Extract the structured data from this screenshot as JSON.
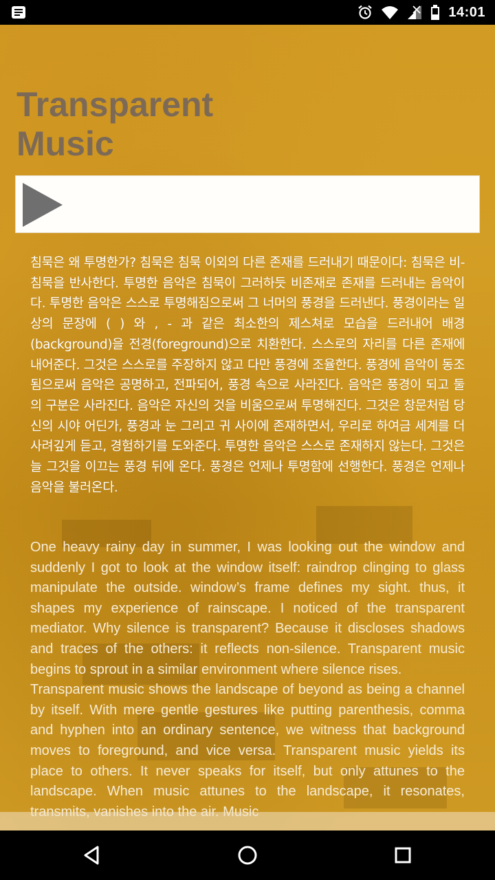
{
  "status_bar": {
    "time": "14:01",
    "icons": [
      "notification-icon",
      "alarm-icon",
      "wifi-icon",
      "signal-icon",
      "battery-icon"
    ]
  },
  "page": {
    "title_line1": "Transparent",
    "title_line2": "Music"
  },
  "player": {
    "play_icon": "play-icon"
  },
  "text": {
    "korean": "침묵은 왜 투명한가? 침묵은 침묵 이외의 다른 존재를 드러내기 때문이다: 침묵은 비-침묵을 반사한다. 투명한 음악은 침묵이 그러하듯 비존재로 존재를 드러내는 음악이다. 투명한 음악은 스스로 투명해짐으로써 그 너머의 풍경을 드러낸다. 풍경이라는 일상의 문장에 ( ) 와 , - 과 같은 최소한의 제스쳐로 모습을 드러내어 배경(background)을 전경(foreground)으로 치환한다. 스스로의 자리를 다른 존재에 내어준다. 그것은 스스로를 주장하지 않고 다만 풍경에 조율한다. 풍경에 음악이 동조됨으로써 음악은 공명하고, 전파되어, 풍경 속으로 사라진다. 음악은 풍경이 되고 둘의 구분은 사라진다. 음악은 자신의 것을 비움으로써 투명해진다. 그것은 창문처럼 당신의 시야 어딘가, 풍경과 눈 그리고 귀 사이에 존재하면서, 우리로 하여금 세계를 더 사려깊게 듣고, 경험하기를 도와준다. 투명한 음악은 스스로 존재하지 않는다. 그것은 늘 그것을 이끄는 풍경 뒤에 온다. 풍경은 언제나 투명함에 선행한다. 풍경은 언제나 음악을 불러온다.",
    "english_p1": "One heavy rainy day in summer, I was looking out the window and suddenly I got to look at the window itself: raindrop clinging to glass manipulate the outside. window’s frame defines my sight. thus, it shapes my experience of rainscape. I noticed of the transparent mediator. Why silence is transparent? Because it discloses shadows and traces of the others: it reflects non-silence. Transparent music begins to sprout in a similar environment where silence rises.",
    "english_p2": "Transparent music shows the landscape of beyond as being a channel by itself. With mere gentle gestures like putting parenthesis, comma and hyphen into an ordinary sentence, we witness that background moves to foreground, and vice versa. Transparent music yields its place to others. It never speaks for itself, but only attunes to the landscape. When music attunes to the landscape, it resonates, transmits, vanishes into the air. Music"
  },
  "nav_bar": {
    "back": "back-icon",
    "home": "home-icon",
    "recents": "recents-icon"
  },
  "colors": {
    "background": "#d29a22",
    "title": "#7c6a57",
    "text": "#ffffff"
  }
}
